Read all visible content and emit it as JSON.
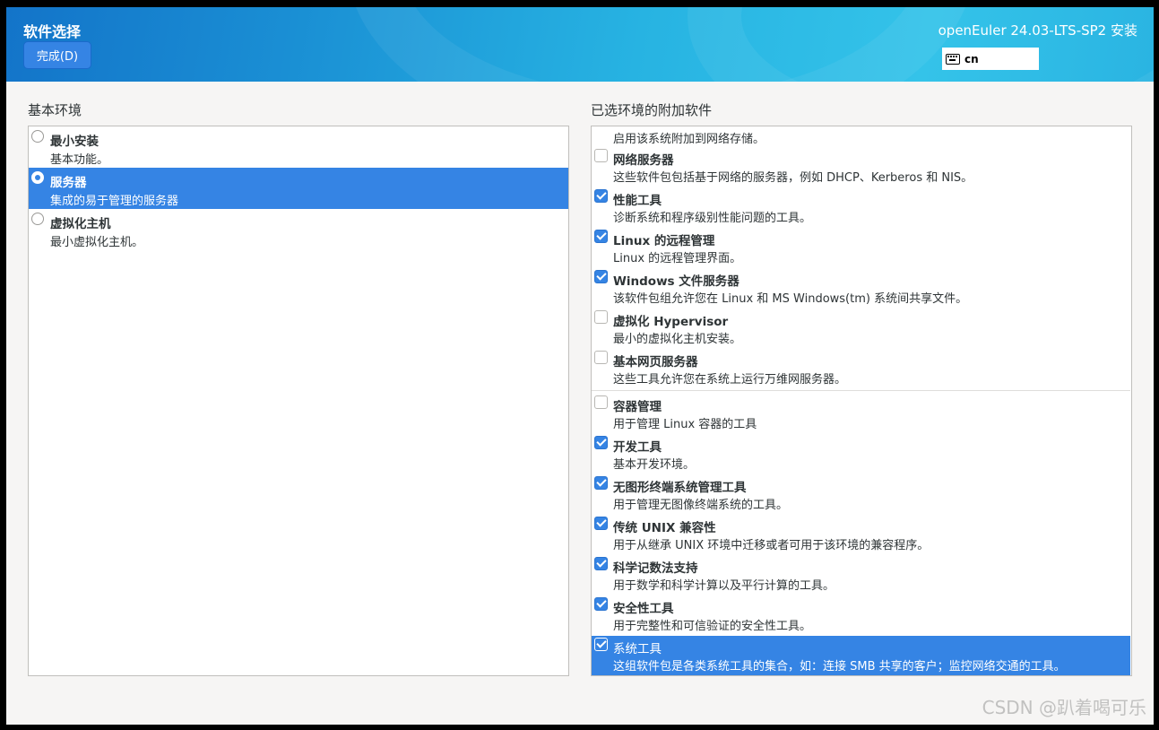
{
  "header": {
    "title": "软件选择",
    "done_label": "完成(D)",
    "product": "openEuler 24.03-LTS-SP2 安装",
    "keyboard_layout": "cn"
  },
  "base_env": {
    "label": "基本环境",
    "items": [
      {
        "name": "最小安装",
        "desc": "基本功能。",
        "selected": false
      },
      {
        "name": "服务器",
        "desc": "集成的易于管理的服务器",
        "selected": true
      },
      {
        "name": "虚拟化主机",
        "desc": "最小虚拟化主机。",
        "selected": false
      }
    ]
  },
  "addons": {
    "label": "已选环境的附加软件",
    "partial_desc": "启用该系统附加到网络存储。",
    "items": [
      {
        "name": "网络服务器",
        "desc": "这些软件包包括基于网络的服务器，例如 DHCP、Kerberos 和 NIS。",
        "checked": false
      },
      {
        "name": "性能工具",
        "desc": "诊断系统和程序级别性能问题的工具。",
        "checked": true
      },
      {
        "name": "Linux 的远程管理",
        "desc": "Linux 的远程管理界面。",
        "checked": true
      },
      {
        "name": "Windows 文件服务器",
        "desc": "该软件包组允许您在 Linux 和 MS Windows(tm) 系统间共享文件。",
        "checked": true
      },
      {
        "name": "虚拟化 Hypervisor",
        "desc": "最小的虚拟化主机安装。",
        "checked": false
      },
      {
        "name": "基本网页服务器",
        "desc": "这些工具允许您在系统上运行万维网服务器。",
        "checked": false
      },
      {
        "name": "容器管理",
        "desc": "用于管理 Linux 容器的工具",
        "checked": false
      },
      {
        "name": "开发工具",
        "desc": "基本开发环境。",
        "checked": true
      },
      {
        "name": "无图形终端系统管理工具",
        "desc": "用于管理无图像终端系统的工具。",
        "checked": true
      },
      {
        "name": "传统 UNIX 兼容性",
        "desc": "用于从继承 UNIX 环境中迁移或者可用于该环境的兼容程序。",
        "checked": true
      },
      {
        "name": "科学记数法支持",
        "desc": "用于数学和科学计算以及平行计算的工具。",
        "checked": true
      },
      {
        "name": "安全性工具",
        "desc": "用于完整性和可信验证的安全性工具。",
        "checked": true
      },
      {
        "name": "系统工具",
        "desc": "这组软件包是各类系统工具的集合，如：连接 SMB 共享的客户；监控网络交通的工具。",
        "checked": true,
        "selected": true
      }
    ]
  },
  "watermark": "CSDN @趴着喝可乐"
}
